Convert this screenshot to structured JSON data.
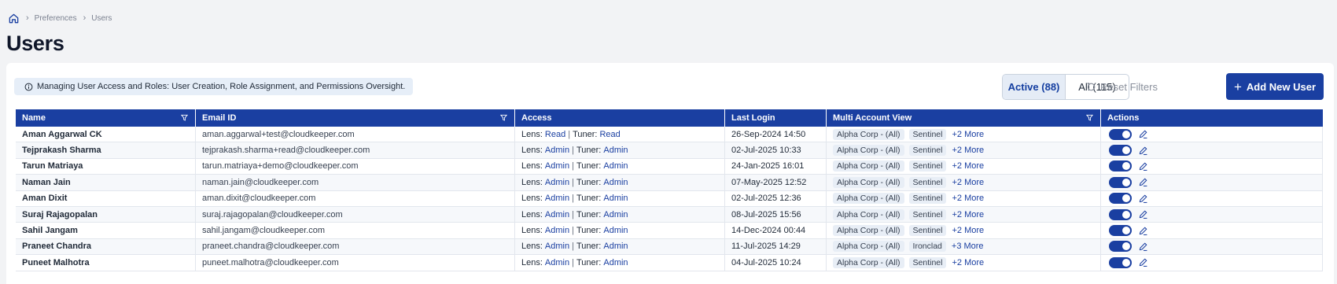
{
  "breadcrumb": {
    "items": [
      "Preferences",
      "Users"
    ]
  },
  "page": {
    "title": "Users"
  },
  "banner": {
    "text": "Managing User Access and Roles: User Creation, Role Assignment, and Permissions Oversight."
  },
  "filters": {
    "active_label": "Active (88)",
    "all_label": "All (115)",
    "reset_label": "Reset Filters"
  },
  "actions": {
    "add_label": "Add New User"
  },
  "table": {
    "columns": [
      "Name",
      "Email ID",
      "Access",
      "Last Login",
      "Multi Account View",
      "Actions"
    ],
    "access_labels": {
      "lens": "Lens:",
      "tuner": "Tuner:",
      "separator": "|"
    },
    "rows": [
      {
        "name": "Aman Aggarwal CK",
        "email": "aman.aggarwal+test@cloudkeeper.com",
        "lens": "Read",
        "tuner": "Read",
        "last_login": "26-Sep-2024 14:50",
        "tags": [
          "Alpha Corp - (All)",
          "Sentinel"
        ],
        "more": "+2 More",
        "enabled": true
      },
      {
        "name": "Tejprakash Sharma",
        "email": "tejprakash.sharma+read@cloudkeeper.com",
        "lens": "Admin",
        "tuner": "Admin",
        "last_login": "02-Jul-2025 10:33",
        "tags": [
          "Alpha Corp - (All)",
          "Sentinel"
        ],
        "more": "+2 More",
        "enabled": true
      },
      {
        "name": "Tarun Matriaya",
        "email": "tarun.matriaya+demo@cloudkeeper.com",
        "lens": "Admin",
        "tuner": "Admin",
        "last_login": "24-Jan-2025 16:01",
        "tags": [
          "Alpha Corp - (All)",
          "Sentinel"
        ],
        "more": "+2 More",
        "enabled": true
      },
      {
        "name": "Naman Jain",
        "email": "naman.jain@cloudkeeper.com",
        "lens": "Admin",
        "tuner": "Admin",
        "last_login": "07-May-2025 12:52",
        "tags": [
          "Alpha Corp - (All)",
          "Sentinel"
        ],
        "more": "+2 More",
        "enabled": true
      },
      {
        "name": "Aman Dixit",
        "email": "aman.dixit@cloudkeeper.com",
        "lens": "Admin",
        "tuner": "Admin",
        "last_login": "02-Jul-2025 12:36",
        "tags": [
          "Alpha Corp - (All)",
          "Sentinel"
        ],
        "more": "+2 More",
        "enabled": true
      },
      {
        "name": "Suraj Rajagopalan",
        "email": "suraj.rajagopalan@cloudkeeper.com",
        "lens": "Admin",
        "tuner": "Admin",
        "last_login": "08-Jul-2025 15:56",
        "tags": [
          "Alpha Corp - (All)",
          "Sentinel"
        ],
        "more": "+2 More",
        "enabled": true
      },
      {
        "name": "Sahil Jangam",
        "email": "sahil.jangam@cloudkeeper.com",
        "lens": "Admin",
        "tuner": "Admin",
        "last_login": "14-Dec-2024 00:44",
        "tags": [
          "Alpha Corp - (All)",
          "Sentinel"
        ],
        "more": "+2 More",
        "enabled": true
      },
      {
        "name": "Praneet Chandra",
        "email": "praneet.chandra@cloudkeeper.com",
        "lens": "Admin",
        "tuner": "Admin",
        "last_login": "11-Jul-2025 14:29",
        "tags": [
          "Alpha Corp - (All)",
          "Ironclad"
        ],
        "more": "+3 More",
        "enabled": true
      },
      {
        "name": "Puneet Malhotra",
        "email": "puneet.malhotra@cloudkeeper.com",
        "lens": "Admin",
        "tuner": "Admin",
        "last_login": "04-Jul-2025 10:24",
        "tags": [
          "Alpha Corp - (All)",
          "Sentinel"
        ],
        "more": "+2 More",
        "enabled": true
      }
    ]
  },
  "colors": {
    "primary": "#1a3fa1",
    "banner_bg": "#e6eef8",
    "page_bg": "#f2f3f5"
  },
  "icons": {
    "home": "home-icon",
    "info": "info-icon",
    "reset": "reset-icon",
    "plus": "plus-icon",
    "filter": "filter-icon",
    "edit": "edit-icon"
  }
}
